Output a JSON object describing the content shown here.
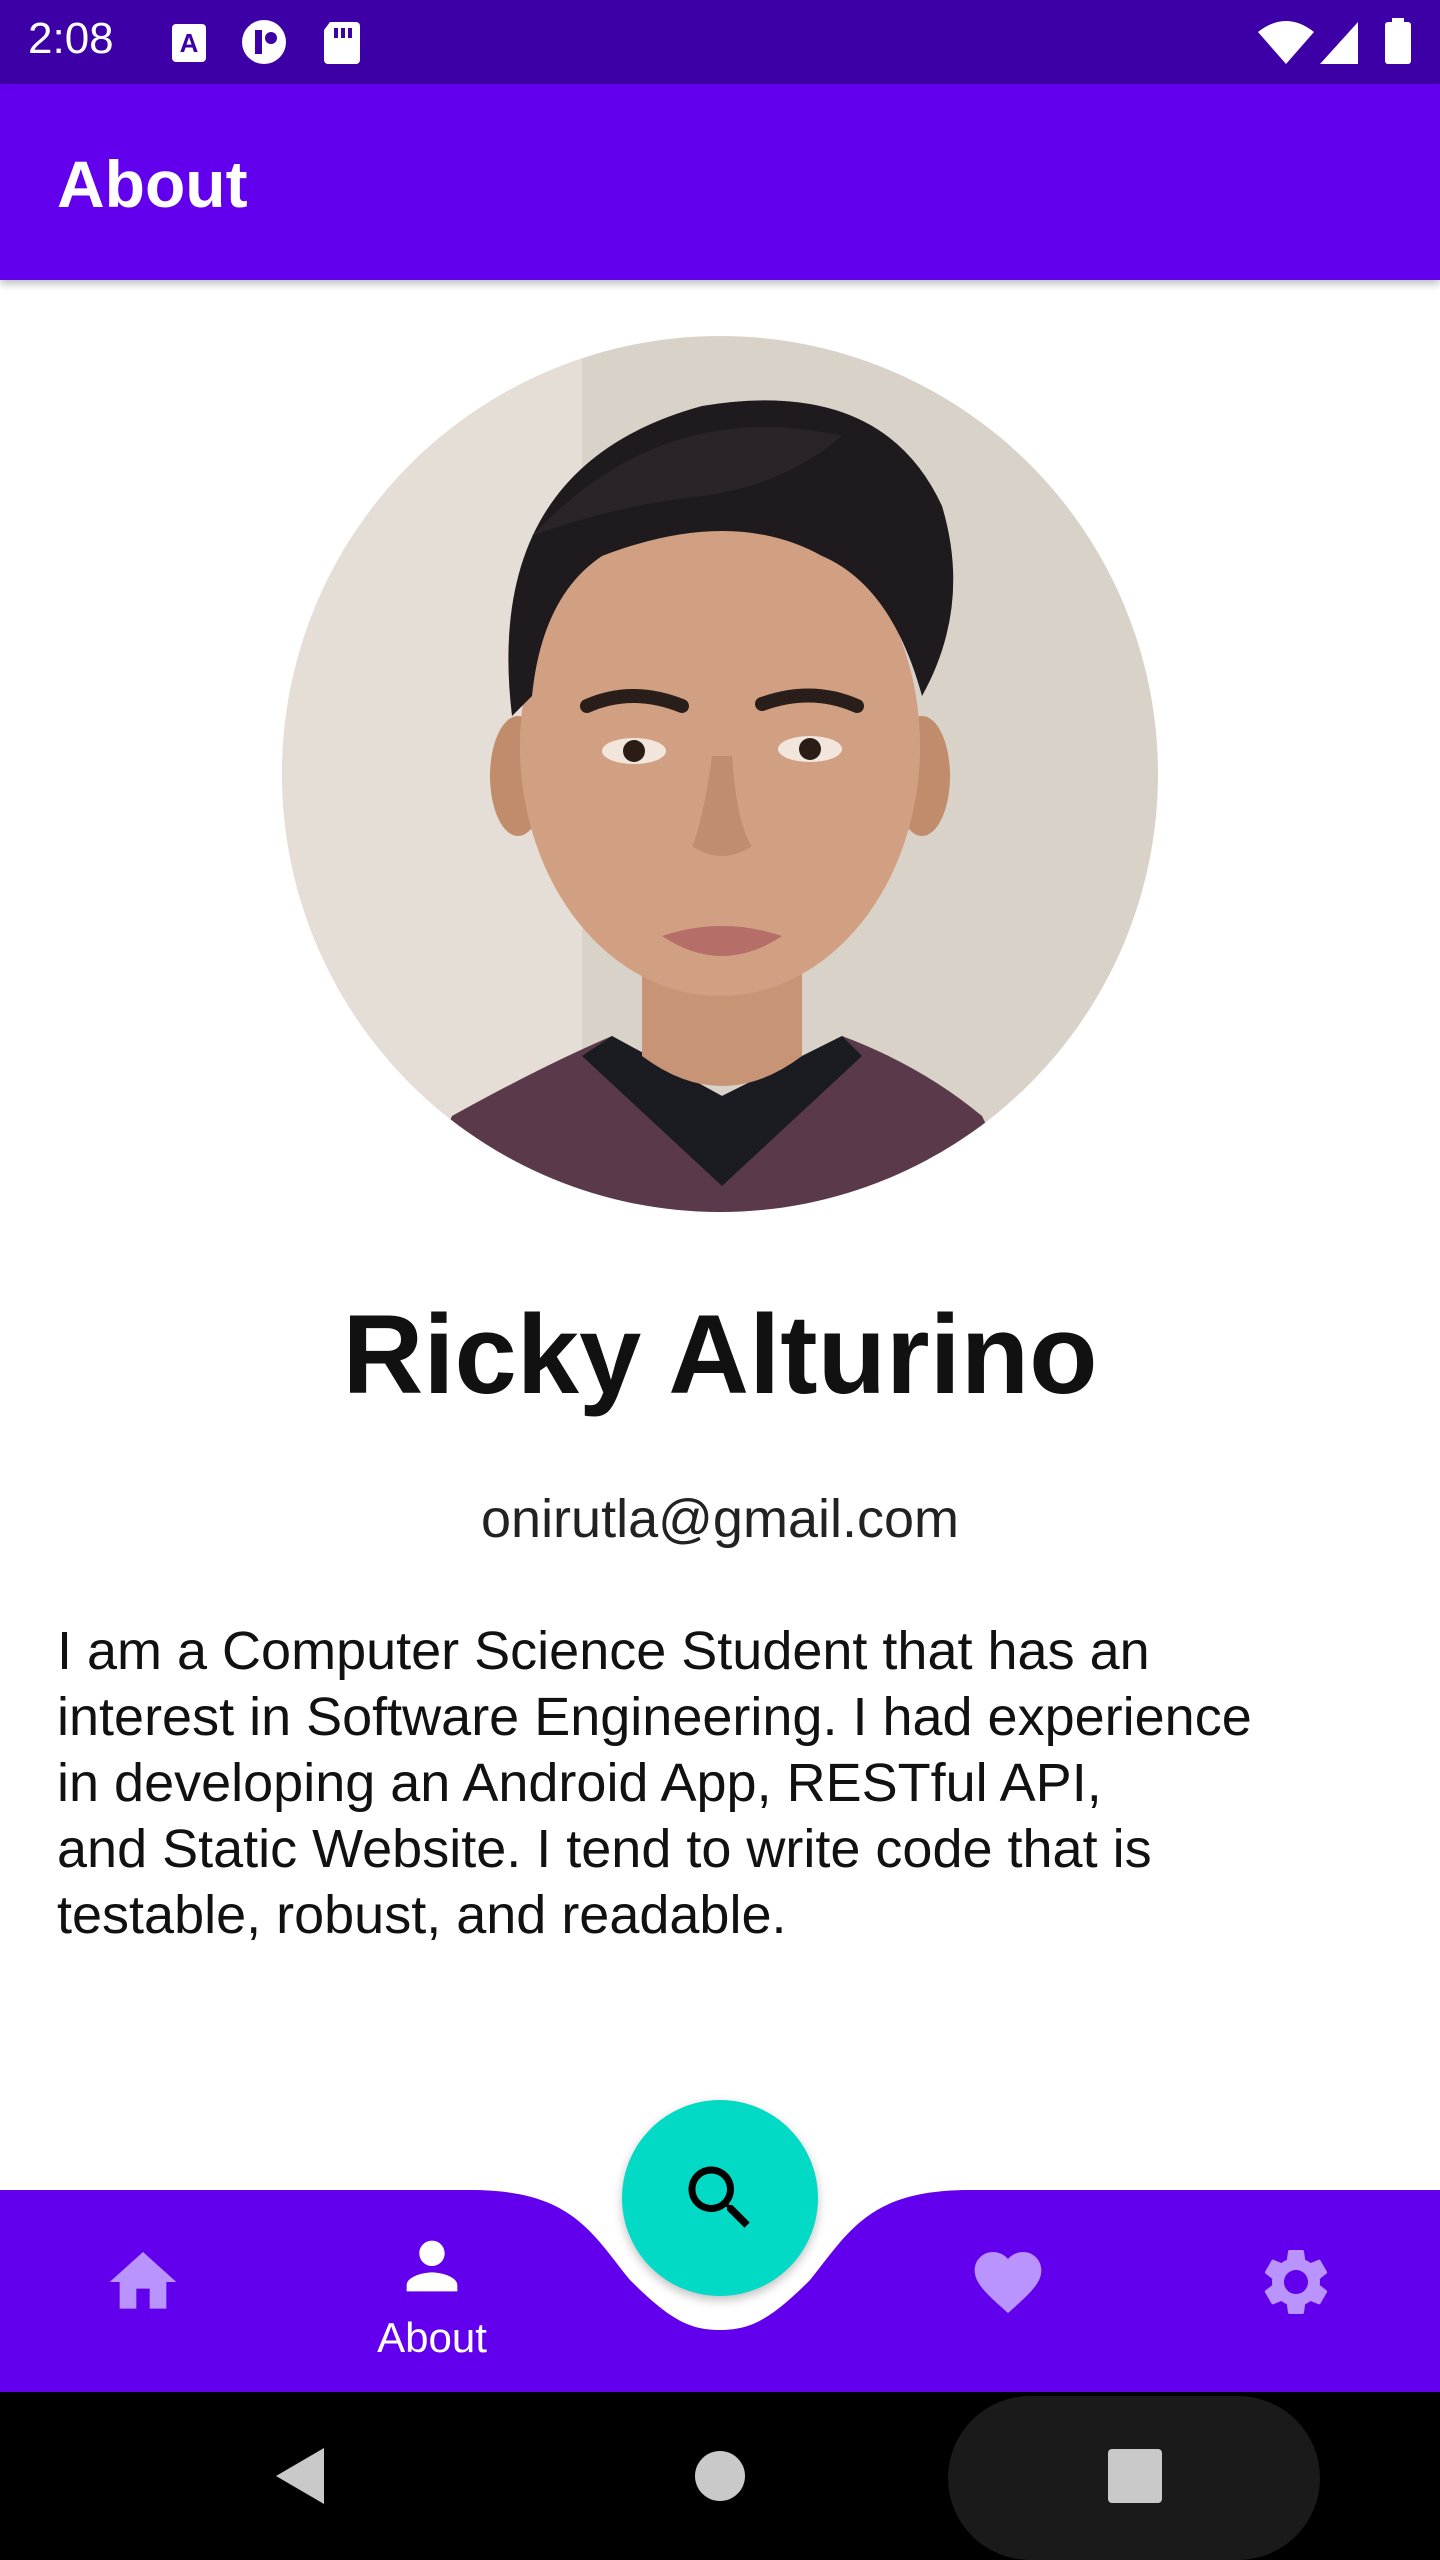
{
  "status_bar": {
    "time": "2:08",
    "icons_left": [
      "a-notification-icon",
      "tracking-icon",
      "sd-card-icon"
    ],
    "icons_right": [
      "wifi-icon",
      "signal-icon",
      "battery-icon"
    ]
  },
  "app_bar": {
    "title": "About"
  },
  "profile": {
    "name": "Ricky Alturino",
    "email": "onirutla@gmail.com",
    "bio": "I am a Computer Science Student that has an\ninterest in Software Engineering. I had experience\nin developing an Android App, RESTful API,\nand Static Website. I tend to write code that is\ntestable, robust, and readable."
  },
  "bottom_nav": {
    "items": [
      {
        "icon": "home-icon",
        "label": ""
      },
      {
        "icon": "person-icon",
        "label": "About",
        "selected": true
      },
      {
        "icon": "heart-icon",
        "label": ""
      },
      {
        "icon": "gear-icon",
        "label": ""
      }
    ],
    "fab_icon": "search-icon"
  },
  "colors": {
    "status_bar": "#3d00a6",
    "primary": "#6200ee",
    "fab": "#03dac5",
    "inactive_icon": "#b994ff",
    "active_icon": "#ffffff"
  }
}
